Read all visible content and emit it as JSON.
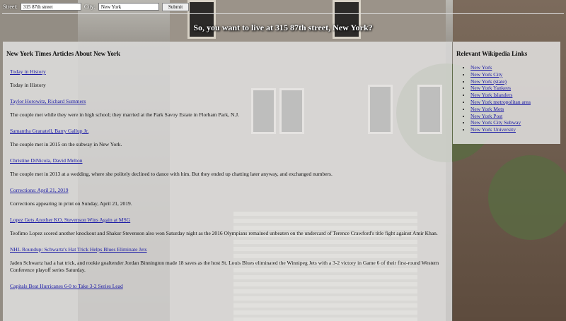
{
  "form": {
    "street_label": "Street:",
    "street_value": "315 87th street",
    "city_label": "City:",
    "city_value": "New York",
    "submit_label": "Submit"
  },
  "headline": "So, you want to live at 315 87th street, New York?",
  "articles": {
    "heading": "New York Times Articles About New York",
    "items": [
      {
        "title": "Today in History",
        "summary": "Today in History"
      },
      {
        "title": "Taylor Horowitz, Richard Summers",
        "summary": "The couple met while they were in high school; they married at the Park Savoy Estate in Florham Park, N.J."
      },
      {
        "title": "Samantha Granatell, Barry Gallup Jr.",
        "summary": "The couple met in 2015 on the subway in New York."
      },
      {
        "title": "Christine DiNicola, David Melton",
        "summary": "The couple met in 2013 at a wedding, where she politely declined to dance with him. But they ended up chatting later anyway, and exchanged numbers."
      },
      {
        "title": "Corrections: April 21, 2019",
        "summary": "Corrections appearing in print on Sunday, April 21, 2019."
      },
      {
        "title": "Lopez Gets Another KO, Stevenson Wins Again at MSG",
        "summary": "Teofimo Lopez scored another knockout and Shakur Stevenson also won Saturday night as the 2016 Olympians remained unbeaten on the undercard of Terence Crawford's title fight against Amir Khan."
      },
      {
        "title": "NHL Roundup: Schwartz's Hat Trick Helps Blues Eliminate Jets",
        "summary": "Jaden Schwartz had a hat trick, and rookie goaltender Jordan Binnington made 18 saves as the host St. Louis Blues eliminated the Winnipeg Jets with a 3-2 victory in Game 6 of their first-round Western Conference playoff series Saturday."
      },
      {
        "title": "Capitals Beat Hurricanes 6-0 to Take 3-2 Series Lead",
        "summary": ""
      }
    ]
  },
  "wiki": {
    "heading": "Relevant Wikipedia Links",
    "links": [
      "New York",
      "New York City",
      "New York (state)",
      "New York Yankees",
      "New York Islanders",
      "New York metropolitan area",
      "New York Mets",
      "New York Post",
      "New York City Subway",
      "New York University"
    ]
  }
}
